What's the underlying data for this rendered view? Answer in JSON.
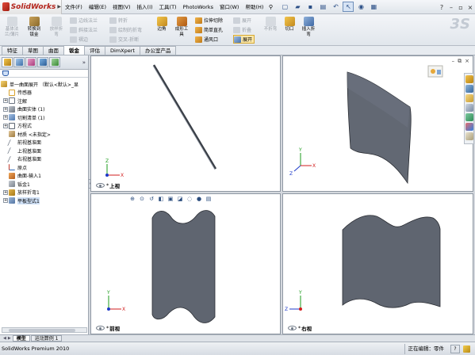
{
  "app": {
    "logo_text": "SolidWorks"
  },
  "menu": [
    "文件(F)",
    "编辑(E)",
    "视图(V)",
    "插入(I)",
    "工具(T)",
    "PhotoWorks",
    "窗口(W)",
    "帮助(H)"
  ],
  "commands": {
    "base_flange": "基体法\n兰/薄片",
    "convert_sheet": "转换到\n钣金",
    "lofted_bend": "放样折\n弯",
    "edge_flange": "边线法兰",
    "miter_flange": "斜接法兰",
    "hem": "褶边",
    "jog": "转折",
    "sketched_bend": "绘制的折弯",
    "cross_break": "交叉-折断",
    "corner": "边角",
    "forming_tool": "成形工\n具",
    "extruded_cut": "拉伸切除",
    "simple_hole": "简单直孔",
    "vent": "通风口",
    "unfold": "展开",
    "fold": "折叠",
    "flatten": "展开",
    "no_bends": "不折弯",
    "rip": "切口",
    "insert_bends": "插入折\n弯"
  },
  "tabs": [
    "特征",
    "草图",
    "曲面",
    "钣金",
    "评估",
    "DimXpert",
    "办公室产品"
  ],
  "active_tab": 3,
  "tree": {
    "root": "单一曲面展开 （默认<默认>_显",
    "items": [
      {
        "label": "传感器",
        "icon": "sensor",
        "expand": false
      },
      {
        "label": "注解",
        "icon": "ann",
        "expand": true
      },
      {
        "label": "曲面实体 (1)",
        "icon": "solid",
        "expand": true
      },
      {
        "label": "切割清单 (1)",
        "icon": "cut",
        "expand": true
      },
      {
        "label": "方程式",
        "icon": "eq",
        "expand": true
      },
      {
        "label": "材质 <未指定>",
        "icon": "mat",
        "expand": false
      },
      {
        "label": "前视基准面",
        "icon": "plane",
        "expand": false
      },
      {
        "label": "上视基准面",
        "icon": "plane",
        "expand": false
      },
      {
        "label": "右视基准面",
        "icon": "plane",
        "expand": false
      },
      {
        "label": "原点",
        "icon": "origin",
        "expand": false
      },
      {
        "label": "曲面-输入1",
        "icon": "surf",
        "expand": false
      },
      {
        "label": "钣金1",
        "icon": "sheet",
        "expand": false
      },
      {
        "label": "放样折弯1",
        "icon": "fold",
        "expand": true
      },
      {
        "label": "平板型式1",
        "icon": "flat",
        "expand": true,
        "selected": true
      }
    ]
  },
  "viewports": {
    "top": "上视",
    "iso": "",
    "front": "前视",
    "right": "右视"
  },
  "bottom_tabs": [
    "模型",
    "运动算例 1"
  ],
  "status": {
    "left": "SolidWorks Premium 2010",
    "right": "正在编辑：零件",
    "help": "?"
  },
  "colors": {
    "part_fill": "#5f6570",
    "part_edge": "#2a2d33",
    "axis_x": "#d21c1c",
    "axis_y": "#1b9b1b",
    "axis_z": "#1c38c8"
  }
}
